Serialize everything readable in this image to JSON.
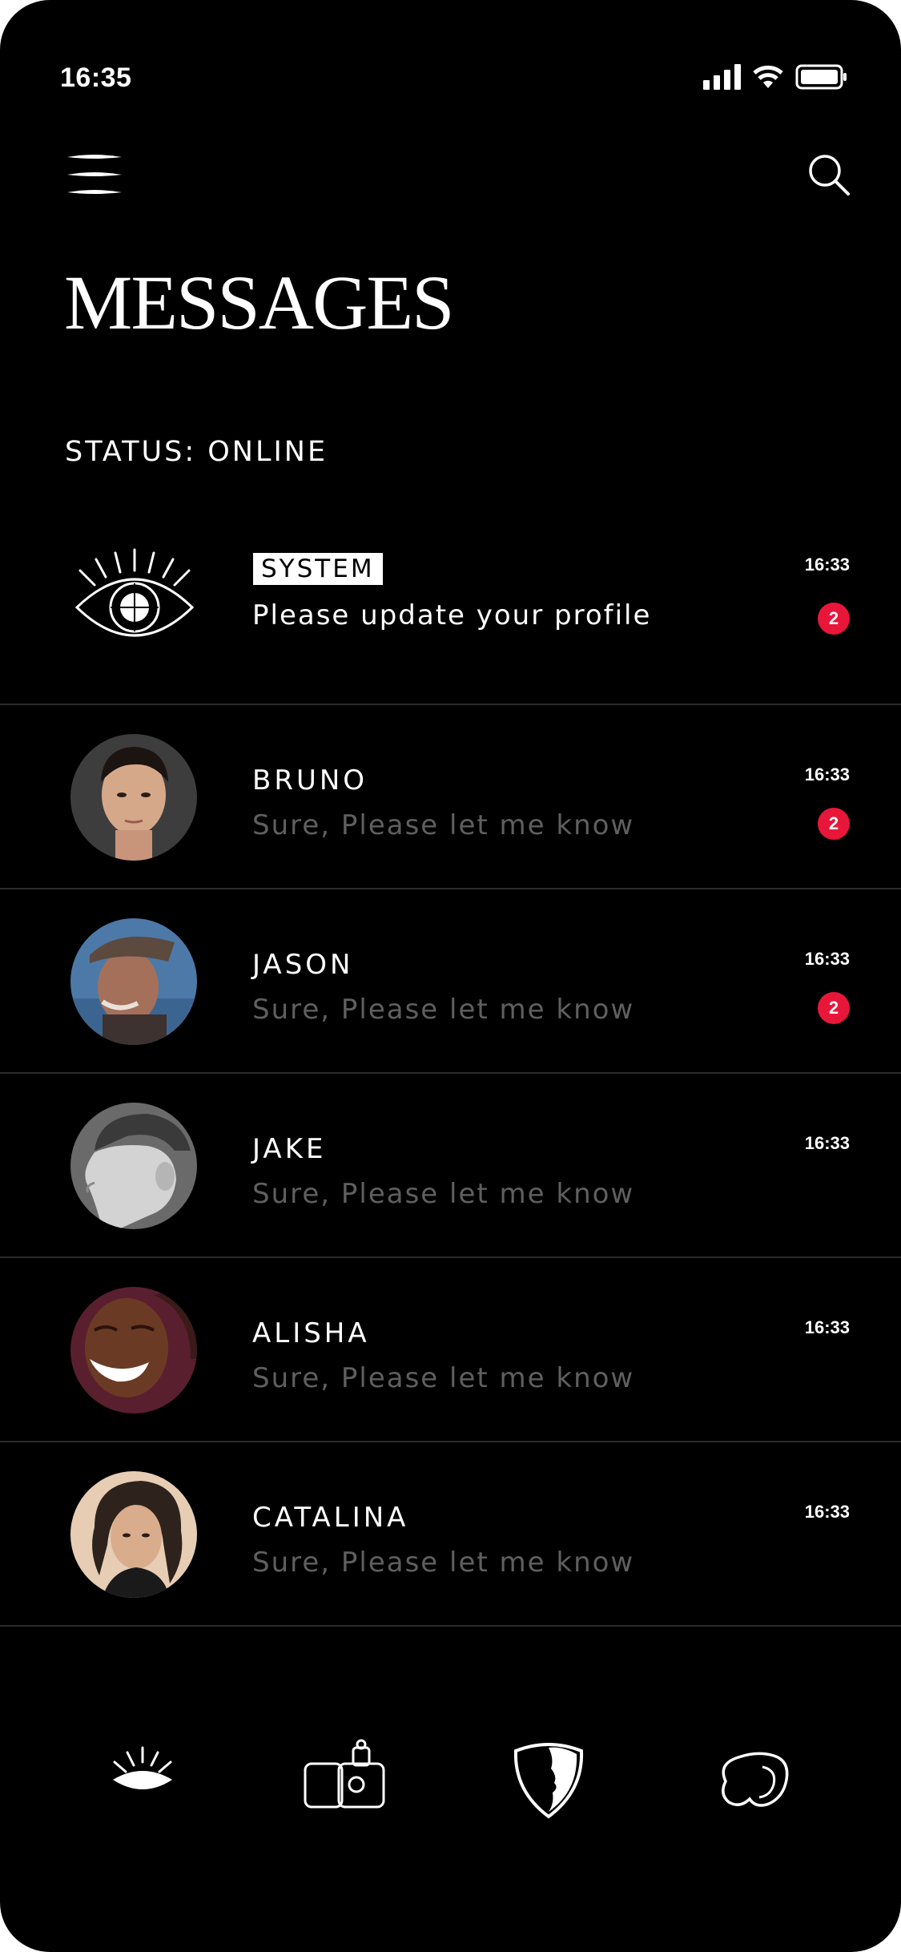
{
  "status_bar": {
    "time": "16:35",
    "icons": [
      "signal-icon",
      "wifi-icon",
      "battery-icon"
    ]
  },
  "header": {
    "menu_icon": "hamburger-menu-icon",
    "search_icon": "search-icon",
    "title": "MESSAGES"
  },
  "presence": {
    "status": "STATUS: ONLINE"
  },
  "conversations": [
    {
      "tag": "SYSTEM",
      "preview": "Please update your profile",
      "time": "16:33",
      "badge": "2",
      "avatar": "eye-icon"
    },
    {
      "name": "BRUNO",
      "preview": "Sure, Please let me know",
      "time": "16:33",
      "badge": "2"
    },
    {
      "name": "JASON",
      "preview": "Sure, Please let me know",
      "time": "16:33",
      "badge": "2"
    },
    {
      "name": "JAKE",
      "preview": "Sure, Please let me know",
      "time": "16:33"
    },
    {
      "name": "ALISHA",
      "preview": "Sure, Please let me know",
      "time": "16:33"
    },
    {
      "name": "CATALINA",
      "preview": "Sure, Please let me know",
      "time": "16:33"
    }
  ],
  "tab_bar": {
    "tabs": [
      "eye-tab-icon",
      "cards-tab-icon",
      "mask-tab-icon",
      "blob-tab-icon"
    ]
  },
  "colors": {
    "background": "#000000",
    "accent": "#e8173a",
    "muted_text": "#5f5f5f"
  }
}
